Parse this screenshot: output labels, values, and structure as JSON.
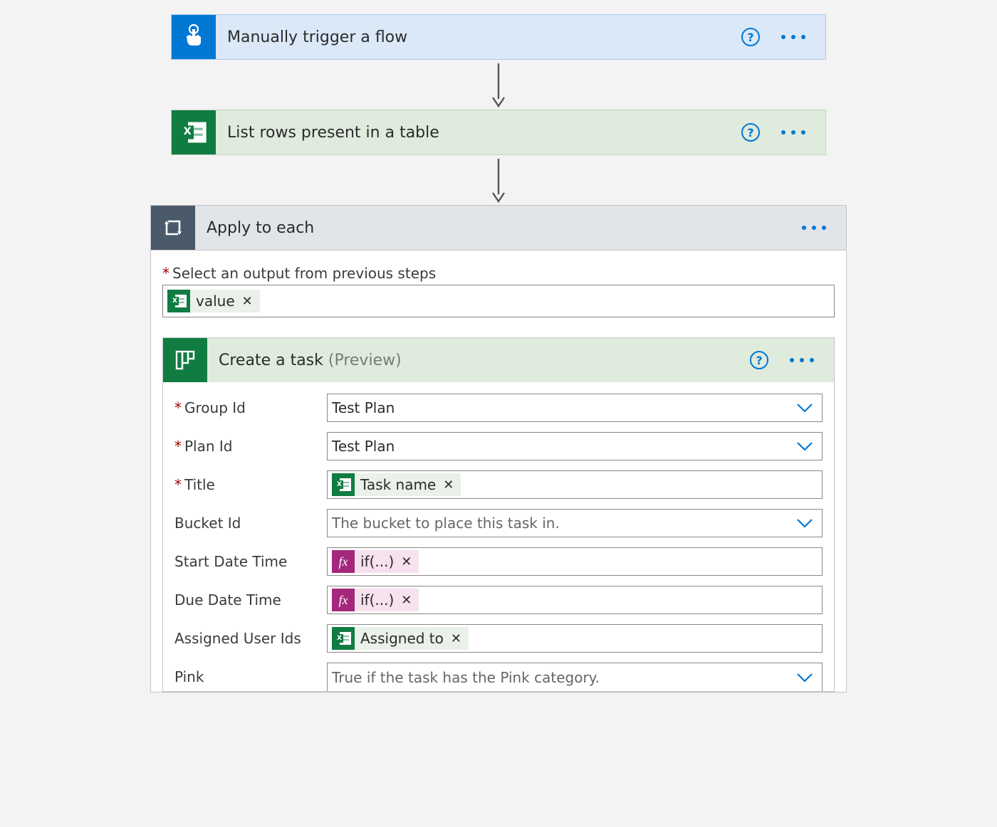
{
  "steps": {
    "trigger": {
      "title": "Manually trigger a flow"
    },
    "listRows": {
      "title": "List rows present in a table"
    },
    "applyToEach": {
      "title": "Apply to each",
      "outputLabel": "Select an output from previous steps",
      "outputToken": "value"
    },
    "createTask": {
      "title": "Create a task ",
      "suffix": "(Preview)",
      "fields": {
        "groupId": {
          "label": "Group Id",
          "value": "Test Plan",
          "required": true,
          "hasDropdown": true
        },
        "planId": {
          "label": "Plan Id",
          "value": "Test Plan",
          "required": true,
          "hasDropdown": true
        },
        "title": {
          "label": "Title",
          "token": "Task name",
          "required": true
        },
        "bucketId": {
          "label": "Bucket Id",
          "placeholder": "The bucket to place this task in.",
          "hasDropdown": true
        },
        "startDate": {
          "label": "Start Date Time",
          "fxToken": "if(...)"
        },
        "dueDate": {
          "label": "Due Date Time",
          "fxToken": "if(...)"
        },
        "assigned": {
          "label": "Assigned User Ids",
          "token": "Assigned to"
        },
        "pink": {
          "label": "Pink",
          "placeholder": "True if the task has the Pink category.",
          "hasDropdown": true
        }
      }
    }
  },
  "glyphs": {
    "help": "?",
    "close": "✕",
    "fx": "fx",
    "xbadge": "X"
  }
}
